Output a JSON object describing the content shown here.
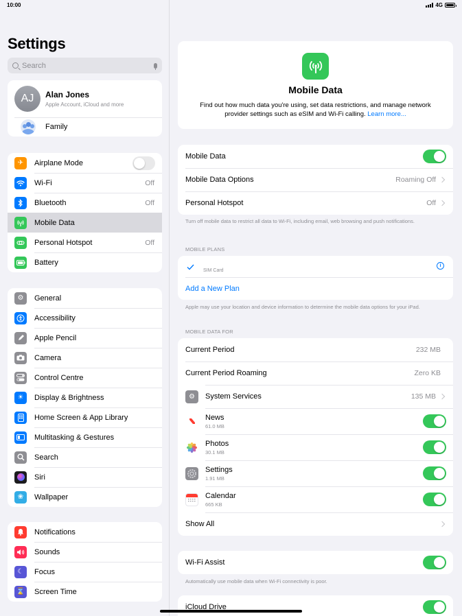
{
  "status": {
    "time": "10:00",
    "network": "4G"
  },
  "sidebar": {
    "title": "Settings",
    "search_placeholder": "Search",
    "account": {
      "initials": "AJ",
      "name": "Alan Jones",
      "subtitle": "Apple Account, iCloud and more",
      "family_label": "Family"
    },
    "group1": [
      {
        "label": "Airplane Mode",
        "icon": "airplane-icon",
        "color": "#ff9500",
        "toggle": false
      },
      {
        "label": "Wi-Fi",
        "value": "Off",
        "icon": "wifi-icon",
        "color": "#007aff"
      },
      {
        "label": "Bluetooth",
        "value": "Off",
        "icon": "bluetooth-icon",
        "color": "#007aff"
      },
      {
        "label": "Mobile Data",
        "icon": "antenna-icon",
        "color": "#34c759",
        "selected": true
      },
      {
        "label": "Personal Hotspot",
        "value": "Off",
        "icon": "hotspot-icon",
        "color": "#34c759"
      },
      {
        "label": "Battery",
        "icon": "battery-icon",
        "color": "#34c759"
      }
    ],
    "group2": [
      {
        "label": "General",
        "icon": "gear-icon",
        "color": "#8e8e93"
      },
      {
        "label": "Accessibility",
        "icon": "accessibility-icon",
        "color": "#007aff"
      },
      {
        "label": "Apple Pencil",
        "icon": "pencil-icon",
        "color": "#8e8e93"
      },
      {
        "label": "Camera",
        "icon": "camera-icon",
        "color": "#8e8e93"
      },
      {
        "label": "Control Centre",
        "icon": "control-centre-icon",
        "color": "#8e8e93"
      },
      {
        "label": "Display & Brightness",
        "icon": "sun-icon",
        "color": "#007aff"
      },
      {
        "label": "Home Screen & App Library",
        "icon": "home-screen-icon",
        "color": "#007aff"
      },
      {
        "label": "Multitasking & Gestures",
        "icon": "multitasking-icon",
        "color": "#007aff"
      },
      {
        "label": "Search",
        "icon": "search-icon",
        "color": "#8e8e93"
      },
      {
        "label": "Siri",
        "icon": "siri-icon",
        "color": "#1c1c1e"
      },
      {
        "label": "Wallpaper",
        "icon": "wallpaper-icon",
        "color": "#32ade6"
      }
    ],
    "group3": [
      {
        "label": "Notifications",
        "icon": "bell-icon",
        "color": "#ff3b30"
      },
      {
        "label": "Sounds",
        "icon": "speaker-icon",
        "color": "#ff2d55"
      },
      {
        "label": "Focus",
        "icon": "moon-icon",
        "color": "#5856d6"
      },
      {
        "label": "Screen Time",
        "icon": "hourglass-icon",
        "color": "#5856d6"
      }
    ]
  },
  "main": {
    "hero": {
      "title": "Mobile Data",
      "description": "Find out how much data you're using, set data restrictions, and manage network provider settings such as eSIM and Wi-Fi calling.",
      "learn_more": "Learn more..."
    },
    "settings": [
      {
        "label": "Mobile Data",
        "toggle": true
      },
      {
        "label": "Mobile Data Options",
        "value": "Roaming Off"
      },
      {
        "label": "Personal Hotspot",
        "value": "Off"
      }
    ],
    "settings_footer": "Turn off mobile data to restrict all data to Wi-Fi, including email, web browsing and push notifications.",
    "plans_header": "MOBILE PLANS",
    "plan_sub": "SIM Card",
    "add_plan": "Add a New Plan",
    "plans_footer": "Apple may use your location and device information to determine the mobile data options for your iPad.",
    "usage_header": "MOBILE DATA FOR",
    "current_period": {
      "label": "Current Period",
      "value": "232 MB"
    },
    "current_roaming": {
      "label": "Current Period Roaming",
      "value": "Zero KB"
    },
    "system_services": {
      "label": "System Services",
      "value": "135 MB"
    },
    "apps": [
      {
        "name": "News",
        "size": "61.0 MB",
        "toggle": true
      },
      {
        "name": "Photos",
        "size": "30.1 MB",
        "toggle": true
      },
      {
        "name": "Settings",
        "size": "1.91 MB",
        "toggle": true
      },
      {
        "name": "Calendar",
        "size": "665 KB",
        "toggle": true
      }
    ],
    "show_all": "Show All",
    "wifi_assist": {
      "label": "Wi-Fi Assist",
      "toggle": true,
      "footer": "Automatically use mobile data when Wi-Fi connectivity is poor."
    },
    "icloud_drive": {
      "label": "iCloud Drive",
      "toggle": true
    }
  }
}
